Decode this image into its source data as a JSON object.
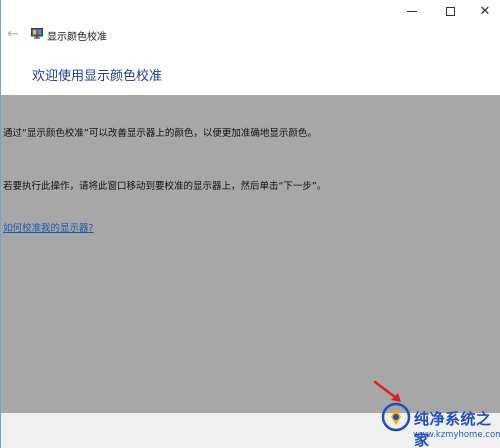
{
  "window": {
    "title": "显示颜色校准",
    "controls": {
      "minimize": "minimize",
      "maximize": "maximize",
      "close": "close"
    }
  },
  "nav": {
    "back_icon": "back-arrow-icon"
  },
  "page": {
    "heading": "欢迎使用显示颜色校准",
    "paragraph1": "通过“显示颜色校准”可以改善显示器上的颜色，以便更加准确地显示颜色。",
    "paragraph2": "若要执行此操作，请将此窗口移动到要校准的显示器上，然后单击“下一步”。",
    "help_link": "如何校准我的显示器?"
  },
  "watermark": {
    "title": "纯净系统之家",
    "url": "www.kzmyhome.com"
  },
  "colors": {
    "heading": "#1e3c9a",
    "content_bg": "#a7a7a7",
    "link": "#1b58b0",
    "annotation_arrow": "#e02020"
  }
}
